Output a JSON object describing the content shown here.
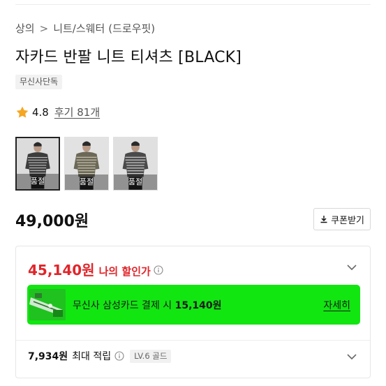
{
  "breadcrumb": {
    "items": [
      "상의",
      "니트/스웨터",
      "(드로우핏)"
    ]
  },
  "product": {
    "title": "자카드 반팔 니트 티셔츠 [BLACK]",
    "tag": "무신사단독",
    "rating_score": "4.8",
    "reviews_label": "후기 81개",
    "thumbnails": [
      {
        "label": "품절",
        "selected": true
      },
      {
        "label": "품절",
        "selected": false
      },
      {
        "label": "품절",
        "selected": false
      }
    ],
    "price": "49,000원",
    "coupon_label": "쿠폰받기"
  },
  "discount": {
    "sale_price": "45,140원",
    "sale_label": "나의 할인가",
    "card_banner": {
      "text_prefix": "무신사 삼성카드 결제 시 ",
      "text_amount": "15,140원",
      "detail_link": "자세히"
    },
    "points": {
      "amount": "7,934원",
      "label": "최대 적립",
      "level": "LV.6 골드"
    }
  },
  "colors": {
    "sale": "#e0262b",
    "banner": "#11e611",
    "star": "#f5a623"
  }
}
